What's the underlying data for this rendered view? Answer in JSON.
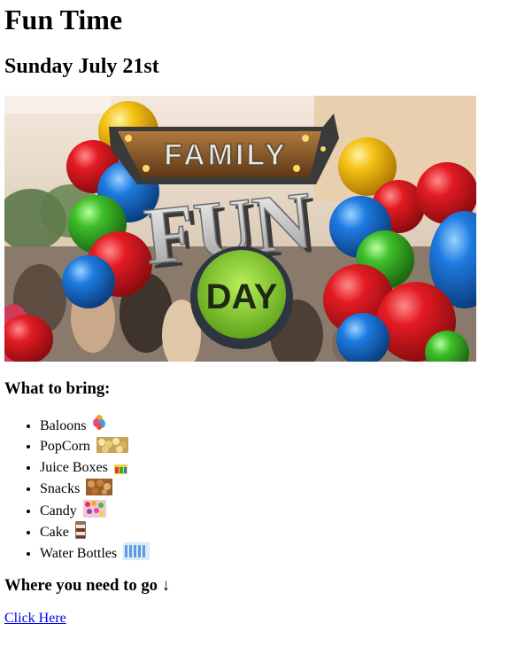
{
  "page": {
    "title": "Fun Time",
    "date": "Sunday July 21st"
  },
  "banner": {
    "text_top": "FAMILY",
    "text_mid": "FUN",
    "text_bottom": "DAY",
    "colors": {
      "sky": "#e9d8c4",
      "crowd": "#7a6b5e",
      "red": "#e31b23",
      "blue": "#1e7be0",
      "green": "#3fbf2a",
      "yellow": "#f5c317",
      "lime": "#8bd832",
      "wood": "#8a5a2b"
    }
  },
  "bring": {
    "heading": "What to bring:",
    "items": [
      {
        "label": "Baloons",
        "icon": "balloons-icon"
      },
      {
        "label": "PopCorn",
        "icon": "popcorn-icon"
      },
      {
        "label": "Juice Boxes",
        "icon": "juice-boxes-icon"
      },
      {
        "label": "Snacks",
        "icon": "snacks-icon"
      },
      {
        "label": "Candy",
        "icon": "candy-icon"
      },
      {
        "label": "Cake",
        "icon": "cake-icon"
      },
      {
        "label": "Water Bottles",
        "icon": "water-bottles-icon"
      }
    ]
  },
  "directions": {
    "heading": "Where you need to go ↓",
    "link_text": "Click Here",
    "link_color": "#0000ee"
  }
}
